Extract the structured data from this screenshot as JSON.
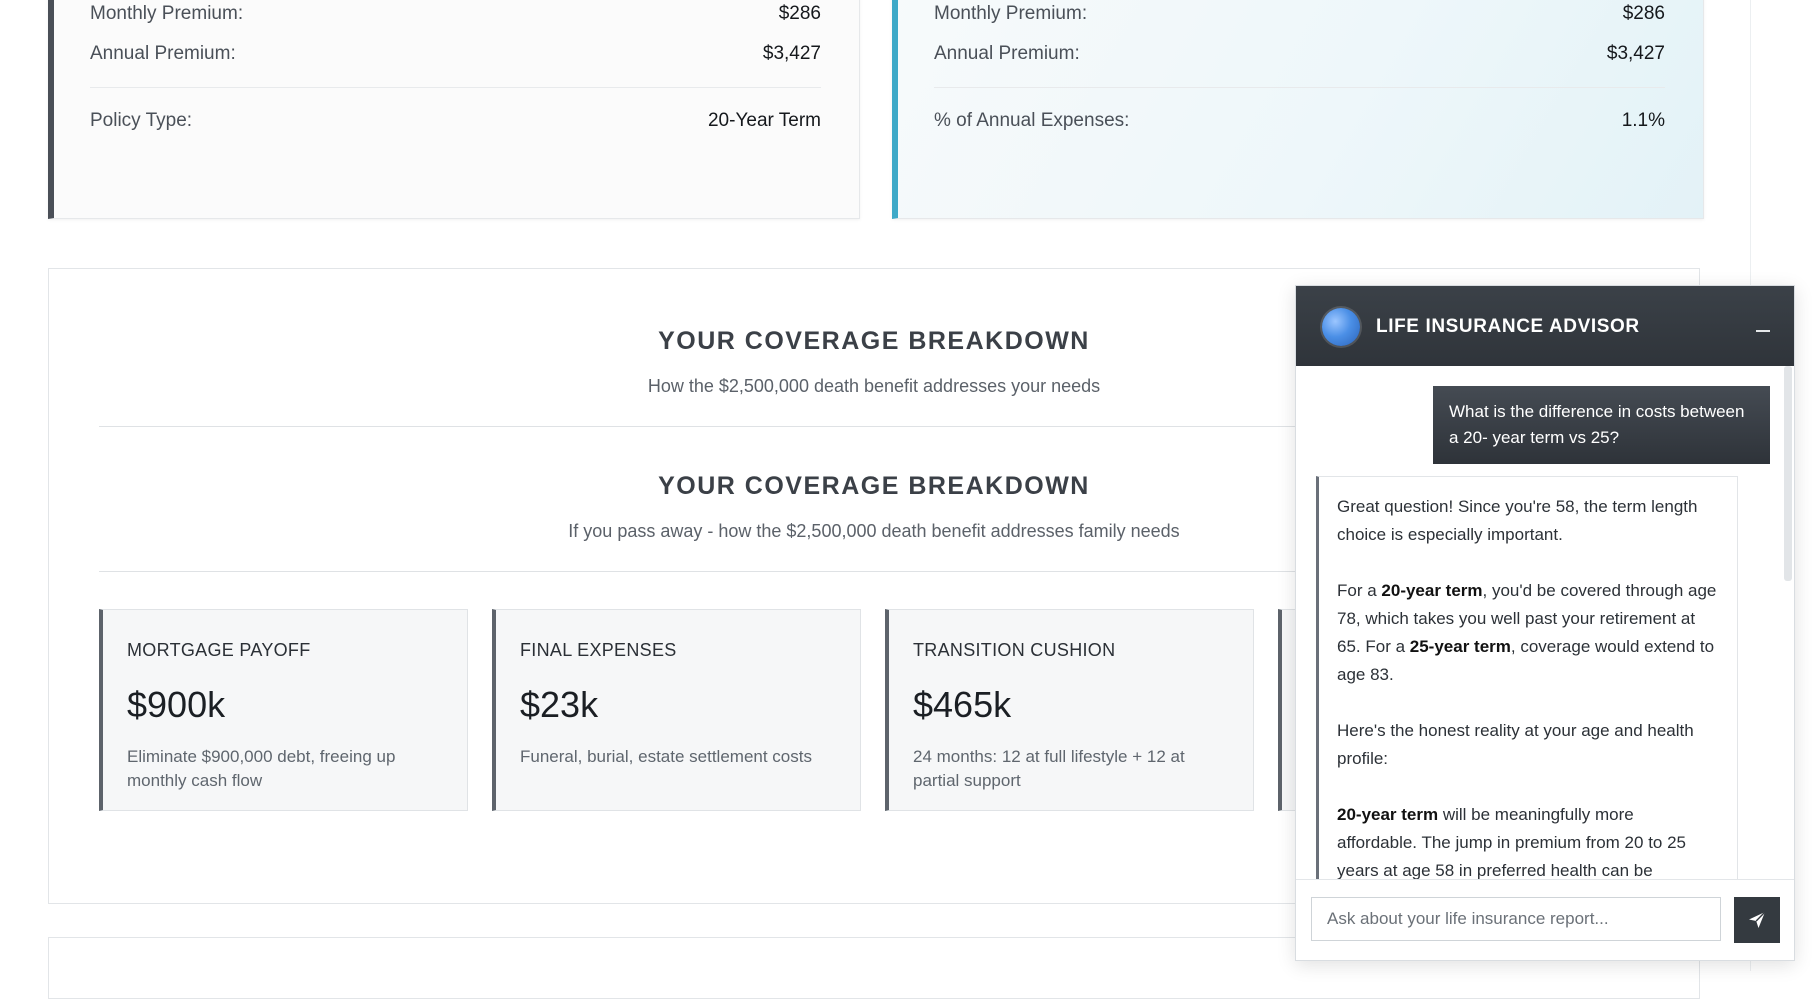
{
  "cost_card": {
    "rows": [
      {
        "label": "Monthly Premium:",
        "value": "$286"
      },
      {
        "label": "Annual Premium:",
        "value": "$3,427"
      },
      {
        "label": "Policy Type:",
        "value": "20-Year Term"
      }
    ]
  },
  "expense_card": {
    "rows": [
      {
        "label": "Monthly Premium:",
        "value": "$286"
      },
      {
        "label": "Annual Premium:",
        "value": "$3,427"
      },
      {
        "label": "% of Annual Expenses:",
        "value": "1.1%"
      }
    ],
    "accent": "#3ea9c8"
  },
  "breakdown": {
    "title_1": "YOUR COVERAGE BREAKDOWN",
    "subtitle_1": "How the $2,500,000 death benefit addresses your needs",
    "title_2": "YOUR COVERAGE BREAKDOWN",
    "subtitle_2": "If you pass away - how the $2,500,000 death benefit addresses family needs",
    "tiles": [
      {
        "name": "MORTGAGE PAYOFF",
        "value": "$900k",
        "desc": "Eliminate $900,000 debt, freeing up monthly cash flow"
      },
      {
        "name": "FINAL EXPENSES",
        "value": "$23k",
        "desc": "Funeral, burial, estate settlement costs"
      },
      {
        "name": "TRANSITION CUSHION",
        "value": "$465k",
        "desc": "24 months: 12 at full lifestyle + 12 at partial support"
      }
    ]
  },
  "chat": {
    "title": "LIFE INSURANCE ADVISOR",
    "user_message": "What is the difference in costs between a 20- year term vs 25?",
    "bot": {
      "p1": "Great question! Since you're 58, the term length choice is especially important.",
      "p2_a": "For a ",
      "p2_b": "20-year term",
      "p2_c": ", you'd be covered through age 78, which takes you well past your retirement at 65. For a ",
      "p2_d": "25-year term",
      "p2_e": ", coverage would extend to age 83.",
      "p3": "Here's the honest reality at your age and health profile:",
      "p4_a": "20-year term",
      "p4_b": " will be meaningfully more affordable. The jump in premium from 20 to 25 years at age 58 in preferred health can be"
    },
    "input_placeholder": "Ask about your life insurance report...",
    "header_color": "#343a40"
  }
}
